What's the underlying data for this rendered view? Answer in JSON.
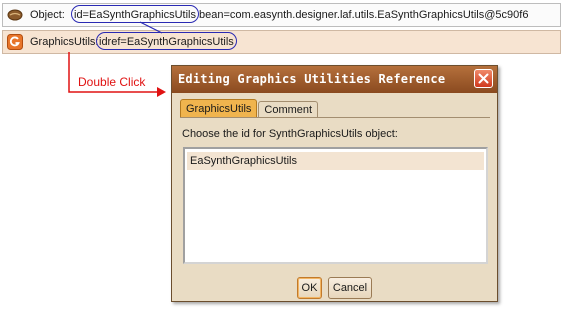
{
  "tree": {
    "row1": {
      "icon": "bean-icon",
      "label": "Object:",
      "id_text": "id=EaSynthGraphicsUtils",
      "bean_text": "bean=com.easynth.designer.laf.utils.EaSynthGraphicsUtils@5c90f6"
    },
    "row2": {
      "icon": "reference-g-icon",
      "label": "GraphicsUtils:",
      "idref_text": "idref=EaSynthGraphicsUtils"
    }
  },
  "annotation": {
    "label": "Double Click",
    "color": "#e01212"
  },
  "dialog": {
    "title": "Editing Graphics Utilities Reference",
    "close_icon": "close-icon",
    "tabs": [
      {
        "label": "GraphicsUtils",
        "active": true
      },
      {
        "label": "Comment",
        "active": false
      }
    ],
    "prompt": "Choose the id for SynthGraphicsUtils object:",
    "list_items": [
      "EaSynthGraphicsUtils"
    ],
    "ok_label": "OK",
    "cancel_label": "Cancel"
  },
  "colors": {
    "title_bar": "#9a5628",
    "dialog_bg": "#e9dcc4",
    "active_tab": "#f0b44e",
    "highlight_oval": "#2a2ab3"
  }
}
